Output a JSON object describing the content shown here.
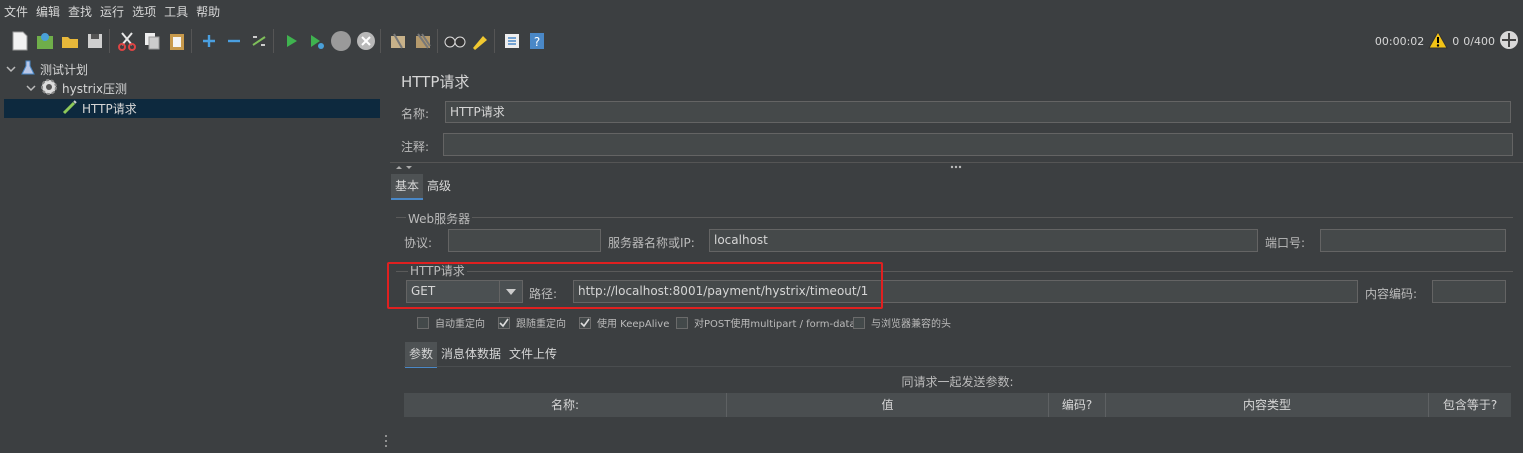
{
  "menu": [
    "文件",
    "编辑",
    "查找",
    "运行",
    "选项",
    "工具",
    "帮助"
  ],
  "toolbar": {
    "icons": [
      "new-icon",
      "templates-icon",
      "open-icon",
      "save-icon",
      "cut-icon",
      "copy-icon",
      "paste-icon",
      "expand-icon",
      "collapse-icon",
      "toggle-icon",
      "start-icon",
      "start-no-pause-icon",
      "stop-icon",
      "shutdown-icon",
      "clear-icon",
      "clear-all-icon",
      "search-icon",
      "reset-search-icon",
      "function-helper-icon",
      "help-icon"
    ],
    "timer": "00:00:02",
    "warnings": "0",
    "threads": "0/400"
  },
  "tree": {
    "items": [
      {
        "label": "测试计划",
        "icon": "test-plan-icon"
      },
      {
        "label": "hystrix压测",
        "icon": "thread-group-icon"
      },
      {
        "label": "HTTP请求",
        "icon": "sampler-icon"
      }
    ]
  },
  "panel": {
    "title": "HTTP请求",
    "name_label": "名称:",
    "name_value": "HTTP请求",
    "comment_label": "注释:",
    "comment_value": "",
    "tabs": [
      "基本",
      "高级"
    ],
    "web_server": {
      "group": "Web服务器",
      "protocol_label": "协议:",
      "protocol_value": "",
      "server_label": "服务器名称或IP:",
      "server_value": "localhost",
      "port_label": "端口号:",
      "port_value": ""
    },
    "http_request": {
      "group": "HTTP请求",
      "method": "GET",
      "path_label": "路径:",
      "path_value": "http://localhost:8001/payment/hystrix/timeout/1",
      "encoding_label": "内容编码:",
      "encoding_value": ""
    },
    "checkboxes": [
      {
        "label": "自动重定向",
        "checked": false
      },
      {
        "label": "跟随重定向",
        "checked": true
      },
      {
        "label": "使用 KeepAlive",
        "checked": true
      },
      {
        "label": "对POST使用multipart / form-data",
        "checked": false
      },
      {
        "label": "与浏览器兼容的头",
        "checked": false
      }
    ],
    "sub_tabs": [
      "参数",
      "消息体数据",
      "文件上传"
    ],
    "params_caption": "同请求一起发送参数:",
    "columns": [
      "名称:",
      "值",
      "编码?",
      "内容类型",
      "包含等于?"
    ]
  }
}
